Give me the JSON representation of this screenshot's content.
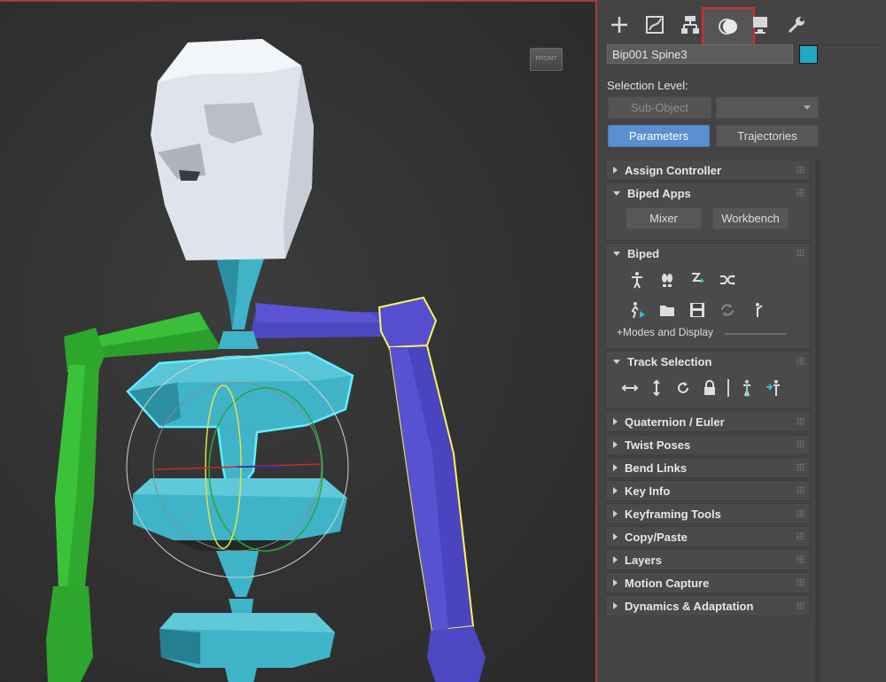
{
  "panel": {
    "tabs": [
      {
        "name": "create-tab",
        "icon": "plus-icon"
      },
      {
        "name": "modify-tab",
        "icon": "modify-curve-icon"
      },
      {
        "name": "hierarchy-tab",
        "icon": "hierarchy-icon"
      },
      {
        "name": "motion-tab",
        "icon": "motion-icon",
        "active": true
      },
      {
        "name": "display-tab",
        "icon": "display-monitor-icon"
      },
      {
        "name": "utilities-tab",
        "icon": "wrench-icon"
      }
    ],
    "object_name": "Bip001 Spine3",
    "object_color": "#20a9c2",
    "selection_level_label": "Selection Level:",
    "sub_object_label": "Sub-Object",
    "parameters_label": "Parameters",
    "trajectories_label": "Trajectories",
    "rollouts": {
      "assign_controller": "Assign Controller",
      "biped_apps": "Biped Apps",
      "mixer": "Mixer",
      "workbench": "Workbench",
      "biped": "Biped",
      "modes_and_display": "+Modes and Display",
      "track_selection": "Track Selection",
      "quaternion_euler": "Quaternion / Euler",
      "twist_poses": "Twist Poses",
      "bend_links": "Bend Links",
      "key_info": "Key Info",
      "keyframing_tools": "Keyframing Tools",
      "copy_paste": "Copy/Paste",
      "layers": "Layers",
      "motion_capture": "Motion Capture",
      "dynamics_adaptation": "Dynamics & Adaptation"
    }
  },
  "viewport": {
    "viewcube_label": "FRONT",
    "colors": {
      "spine": "#3fb4c8",
      "left_arm": "#2fb02f",
      "right_arm": "#4d47c4",
      "head": "#e8ecf2",
      "selection": "#5ef0ff"
    }
  }
}
